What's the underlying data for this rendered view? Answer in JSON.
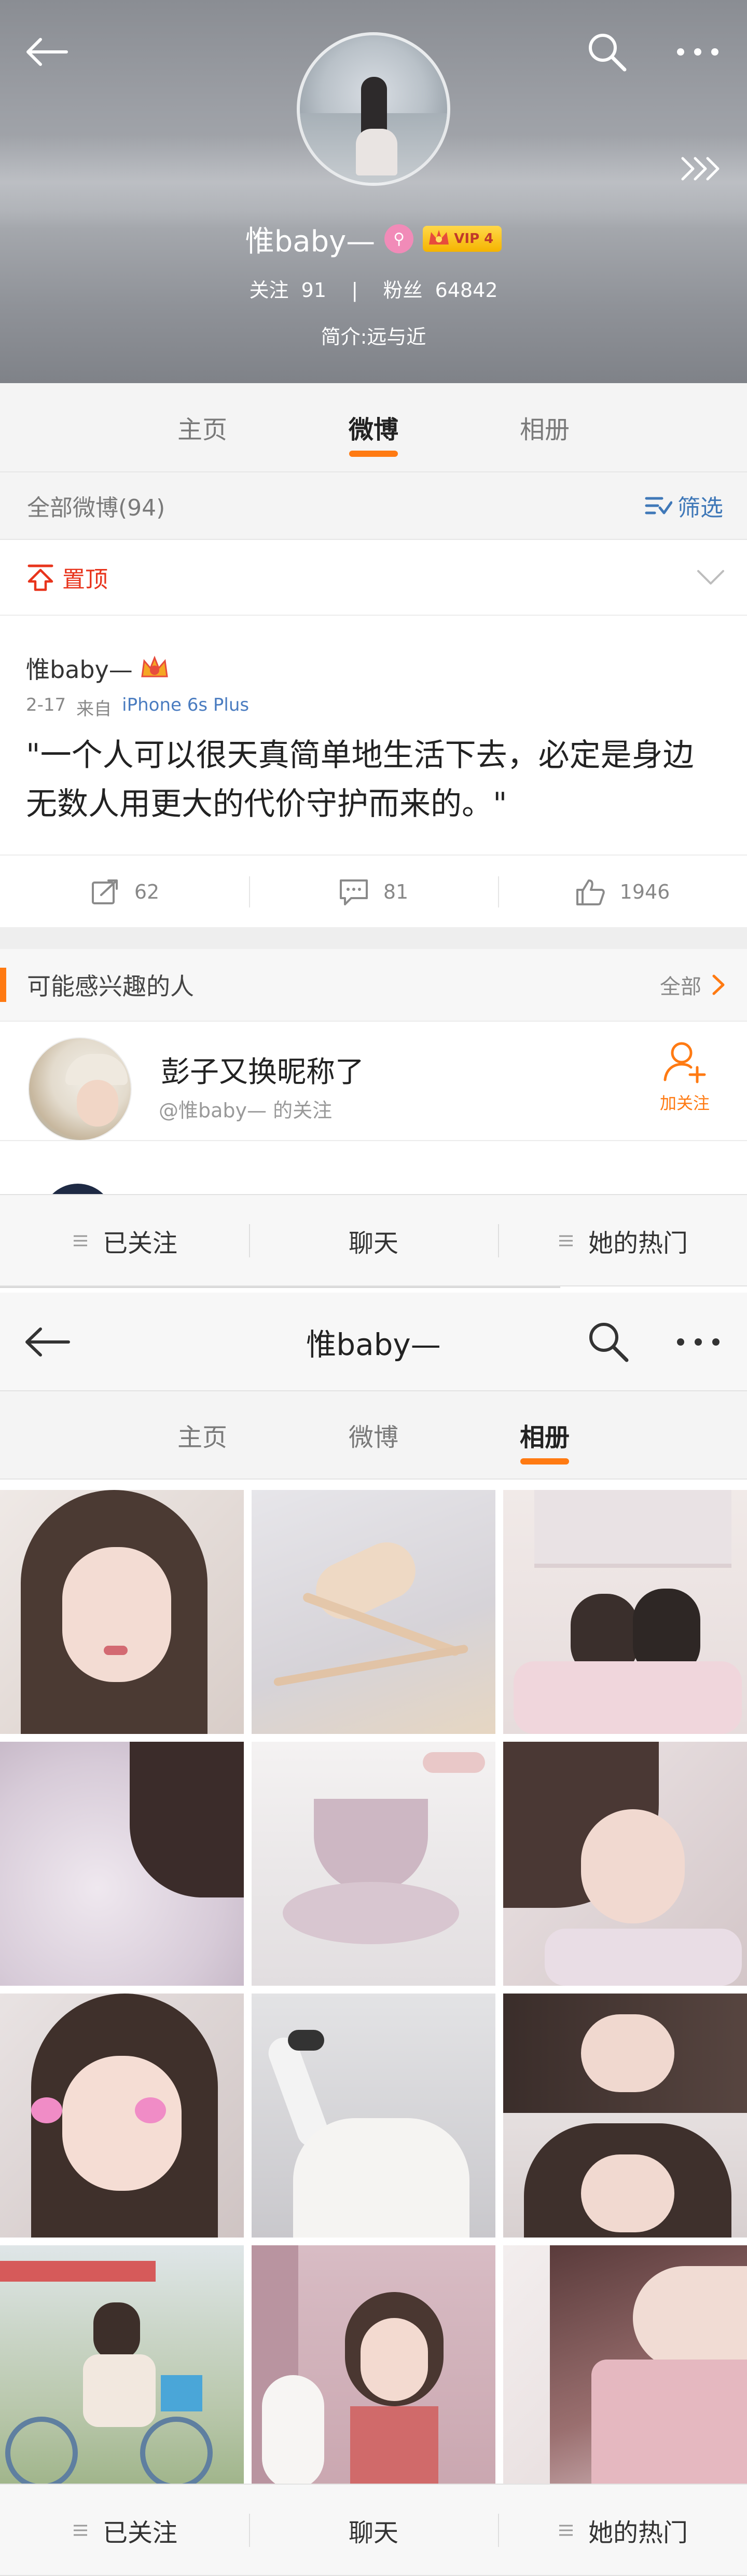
{
  "profile": {
    "name": "惟baby—",
    "vip_label": "VIP 4",
    "stats_text": "关注  91    |    粉丝  64842",
    "bio": "简介:远与近"
  },
  "tabs": [
    "主页",
    "微博",
    "相册"
  ],
  "tabs_top_active": "微博",
  "tabs_album_active": "相册",
  "filter": {
    "label": "全部微博(94)",
    "button": "筛选"
  },
  "pinned": {
    "label": "置顶"
  },
  "post": {
    "author": "惟baby—",
    "date": "2-17",
    "source_prefix": "来自",
    "source": "iPhone 6s Plus",
    "text": "\"一个人可以很天真简单地生活下去，必定是身边无数人用更大的代价守护而来的。\"",
    "reposts": "62",
    "comments": "81",
    "likes": "1946"
  },
  "suggest": {
    "title": "可能感兴趣的人",
    "all_label": "全部",
    "item_name": "彭子又换昵称了",
    "item_sub": "@惟baby—  的关注",
    "follow_label": "加关注"
  },
  "bottom_bar": {
    "followed": "已关注",
    "chat": "聊天",
    "hot": "她的热门"
  },
  "album_nav": {
    "title": "惟baby—"
  },
  "colors": {
    "accent": "#ff7a12",
    "link": "#3f78b8",
    "pinned_red": "#e8341c"
  },
  "icons": [
    "back-arrow-icon",
    "search-icon",
    "more-icon",
    "forward-chevrons-icon",
    "filter-icon",
    "pin-top-icon",
    "chevron-down-icon",
    "repost-icon",
    "comment-icon",
    "like-icon",
    "add-user-icon",
    "menu-lines-icon",
    "crown-icon"
  ]
}
